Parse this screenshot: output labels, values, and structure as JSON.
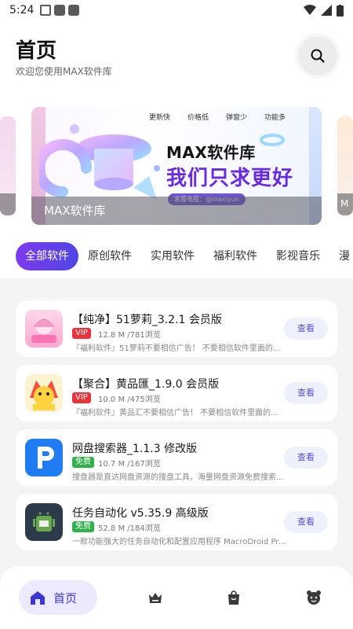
{
  "status_bar": {
    "time": "5:24"
  },
  "header": {
    "title": "首页",
    "subtitle": "欢迎您使用MAX软件库"
  },
  "banner": {
    "features": [
      "更新快",
      "价格低",
      "弹窗少",
      "功能多"
    ],
    "headline": "MAX软件库",
    "slogan": "我们只求更好",
    "pill": "客服电报：@maxiyun",
    "label": "MAX软件库",
    "right_peek_label": "M"
  },
  "tabs": [
    "全部软件",
    "原创软件",
    "实用软件",
    "福利软件",
    "影视音乐",
    "漫画"
  ],
  "apps": [
    {
      "name": "【纯净】51萝莉_3.2.1 会员版",
      "badge": "VIP",
      "meta": "12.8 M /781浏览",
      "desc": "『福利软件』51萝莉不要相信广告！ 不要相信软件里面的...",
      "button": "查看"
    },
    {
      "name": "【聚合】黄品匯_1.9.0 会员版",
      "badge": "VIP",
      "meta": "10.0 M /475浏览",
      "desc": "『福利软件』黄品汇不要相信广告！ 不要相信软件里面的...",
      "button": "查看"
    },
    {
      "name": "网盘搜索器_1.1.3 修改版",
      "badge": "免费",
      "meta": "10.7 M /167浏览",
      "desc": "搜盘器是直达网盘资源的搜盘工具，海量网盘资源免费搜索...",
      "button": "查看"
    },
    {
      "name": "任务自动化 v5.35.9 高级版",
      "badge": "免费",
      "meta": "52.8 M /184浏览",
      "desc": "一款功能强大的任务自动化和配置应用程序 MacroDroid Pr...",
      "button": "查看"
    }
  ],
  "bottom_nav": {
    "home_label": "首页"
  },
  "colors": {
    "accent": "#5b4ed6",
    "vip": "#e8333b",
    "free": "#2fb24a"
  }
}
